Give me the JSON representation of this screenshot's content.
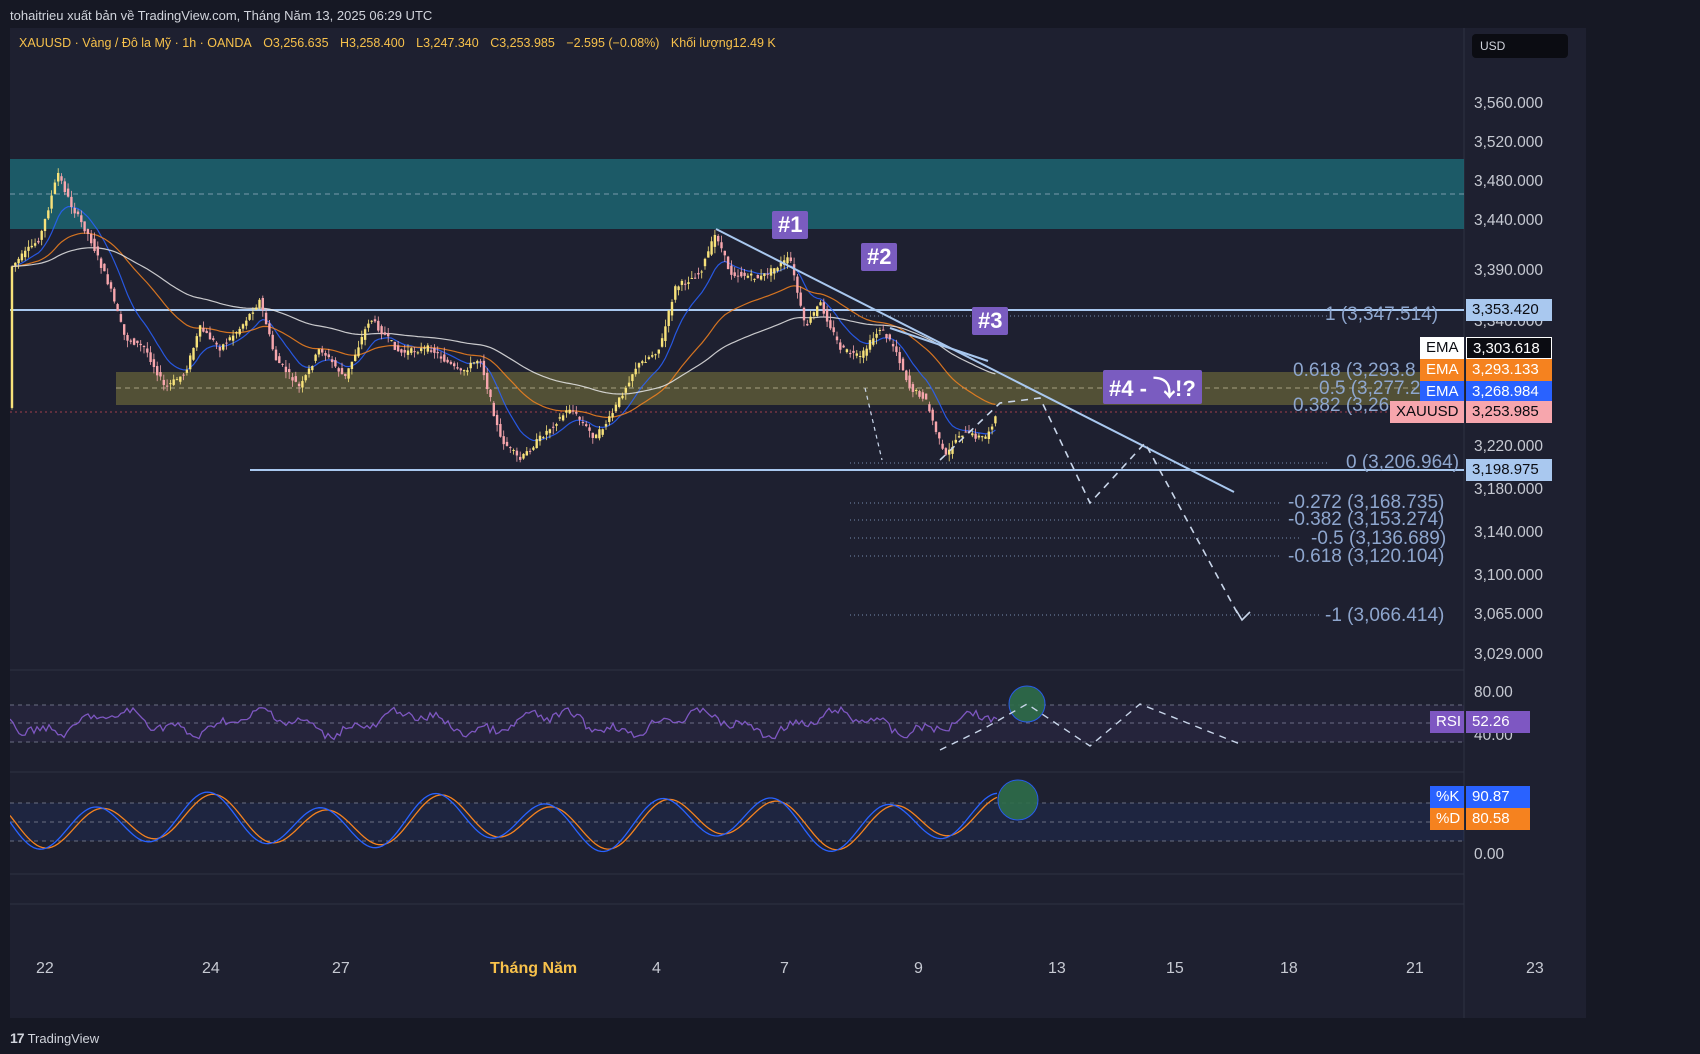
{
  "published": "tohaitrieu xuất bản về TradingView.com, Tháng Năm 13, 2025 06:29 UTC",
  "header": {
    "symbol_line": "XAUUSD · Vàng / Đô la Mỹ · 1h · OANDA",
    "open": "O3,256.635",
    "high": "H3,258.400",
    "low": "L3,247.340",
    "close": "C3,253.985",
    "change": "−2.595 (−0.08%)",
    "volume_label": "Khối lượng",
    "volume": "12.49 K"
  },
  "currency": "USD",
  "price_axis": [
    "3,560.000",
    "3,520.000",
    "3,480.000",
    "3,440.000",
    "3,390.000",
    "3,340.000",
    "3,220.000",
    "3,180.000",
    "3,140.000",
    "3,100.000",
    "3,065.000",
    "3,029.000"
  ],
  "price_tags": {
    "level_1": "3,353.420",
    "ema1_label": "EMA",
    "ema1_value": "3,303.618",
    "ema2_label": "EMA",
    "ema2_value": "3,293.133",
    "ema3_label": "EMA",
    "ema3_value": "3,268.984",
    "symbol_label": "XAUUSD",
    "symbol_value": "3,253.985",
    "level_0": "3,198.975"
  },
  "fib_levels": [
    {
      "text": "1 (3,347.514)"
    },
    {
      "text": "0.618 (3,293.8"
    },
    {
      "text": "0.5 (3,277.2"
    },
    {
      "text": "0.382 (3,26"
    },
    {
      "text": "0 (3,206.964)"
    },
    {
      "text": "-0.272 (3,168.735)"
    },
    {
      "text": "-0.382 (3,153.274)"
    },
    {
      "text": "-0.5 (3,136.689)"
    },
    {
      "text": "-0.618 (3,120.104)"
    },
    {
      "text": "-1 (3,066.414)"
    }
  ],
  "waves": {
    "w1": "#1",
    "w2": "#2",
    "w3": "#3",
    "w4": "#4 - ⤵!?"
  },
  "rsi": {
    "axis_top": "80.00",
    "axis_bottom": "40.00",
    "label": "RSI",
    "value": "52.26"
  },
  "stoch": {
    "axis_bottom": "0.00",
    "k_label": "%K",
    "k_value": "90.87",
    "d_label": "%D",
    "d_value": "80.58"
  },
  "time_axis": [
    "22",
    "24",
    "27",
    "Tháng Năm",
    "4",
    "7",
    "9",
    "13",
    "15",
    "18",
    "21",
    "23"
  ],
  "brand": "TradingView",
  "colors": {
    "ema_white": "#ffffff",
    "ema_orange": "#f5821f",
    "ema_blue": "#2962ff",
    "symbol_red": "#f7525f",
    "zone_teal": "#1c6e7a",
    "zone_olive": "#6e6a3a",
    "rsi_purple": "#7e57c2"
  }
}
